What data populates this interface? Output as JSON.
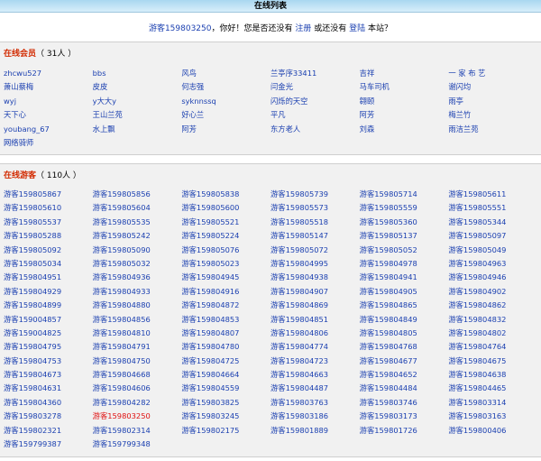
{
  "page": {
    "title": "在线列表"
  },
  "welcome": {
    "user": "游客159803250",
    "text1": "，你好！您是否还没有",
    "register": "注册",
    "text2": "或还没有",
    "login": "登陆",
    "text3": "本站？"
  },
  "members": {
    "title": "在线会员",
    "count": "（ 31人 ）",
    "items": [
      "zhcwu527",
      "bbs",
      "风鸟",
      "兰亭序33411",
      "吉祥",
      "一 家 布 艺",
      "萧山蔡梅",
      "皮皮",
      "何志强",
      "闫金光",
      "马车司机",
      "谢闪均",
      "wyj",
      "y大大y",
      "syknnssq",
      "闪烁的天空",
      "翱颐",
      "雨亭",
      "天下心",
      "王山兰苑",
      "好心兰",
      "平凡",
      "阿芳",
      "梅兰竹",
      "youbang_67",
      "水上飘",
      "阿芳",
      "东方老人",
      "刘森",
      "雨洁兰苑",
      "网络骑师"
    ]
  },
  "guests": {
    "title": "在线游客",
    "count": "（ 110人 ）",
    "current_user": "游客159803250",
    "items": [
      "游客159805867",
      "游客159805856",
      "游客159805838",
      "游客159805739",
      "游客159805714",
      "游客159805611",
      "游客159805610",
      "游客159805604",
      "游客159805600",
      "游客159805573",
      "游客159805559",
      "游客159805551",
      "游客159805537",
      "游客159805535",
      "游客159805521",
      "游客159805518",
      "游客159805360",
      "游客159805344",
      "游客159805288",
      "游客159805242",
      "游客159805224",
      "游客159805147",
      "游客159805137",
      "游客159805097",
      "游客159805092",
      "游客159805090",
      "游客159805076",
      "游客159805072",
      "游客159805052",
      "游客159805049",
      "游客159805034",
      "游客159805032",
      "游客159805023",
      "游客159804995",
      "游客159804978",
      "游客159804963",
      "游客159804951",
      "游客159804936",
      "游客159804945",
      "游客159804938",
      "游客159804941",
      "游客159804946",
      "游客159804929",
      "游客159804933",
      "游客159804916",
      "游客159804907",
      "游客159804905",
      "游客159804902",
      "游客159804899",
      "游客159804880",
      "游客159804872",
      "游客159804869",
      "游客159804865",
      "游客159804862",
      "游客159004857",
      "游客159804856",
      "游客159804853",
      "游客159804851",
      "游客159804849",
      "游客159804832",
      "游客159004825",
      "游客159804810",
      "游客159804807",
      "游客159804806",
      "游客159804805",
      "游客159804802",
      "游客159804795",
      "游客159804791",
      "游客159804780",
      "游客159804774",
      "游客159804768",
      "游客159804764",
      "游客159804753",
      "游客159804750",
      "游客159804725",
      "游客159804723",
      "游客159804677",
      "游客159804675",
      "游客159804673",
      "游客159804668",
      "游客159804664",
      "游客159804663",
      "游客159804652",
      "游客159804638",
      "游客159804631",
      "游客159804606",
      "游客159804559",
      "游客159804487",
      "游客159804484",
      "游客159804465",
      "游客159804360",
      "游客159804282",
      "游客159803825",
      "游客159803763",
      "游客159803746",
      "游客159803314",
      "游客159803278",
      "游客159803250",
      "游客159803245",
      "游客159803186",
      "游客159803173",
      "游客159803163",
      "游客159802321",
      "游客159802314",
      "游客159802175",
      "游客159801889",
      "游客159801726",
      "游客159800406",
      "游客159799387",
      "游客159799348"
    ]
  },
  "colors": {
    "link": "#1a3fb0",
    "section_title": "#d22a00",
    "current_user": "#e01010"
  }
}
